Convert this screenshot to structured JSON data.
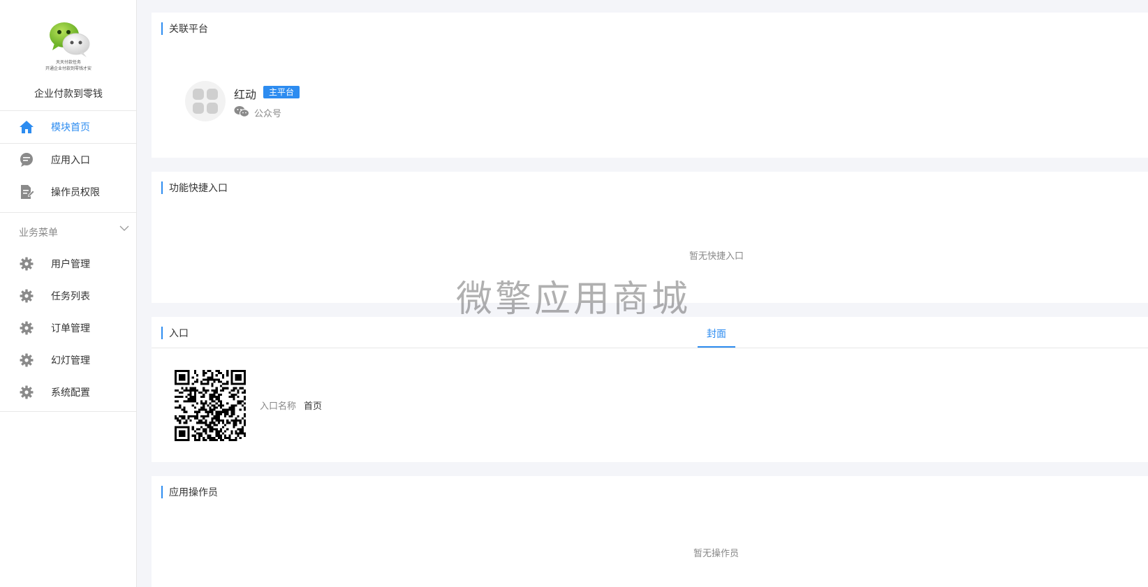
{
  "sidebar": {
    "logo_caption_line1": "天天付款任务",
    "logo_caption_line2": "开通企业付款到零钱才安",
    "app_name": "企业付款到零钱",
    "nav": [
      {
        "label": "模块首页",
        "icon": "home-icon",
        "active": true
      },
      {
        "label": "应用入口",
        "icon": "chat-bubble-icon"
      },
      {
        "label": "操作员权限",
        "icon": "document-edit-icon"
      }
    ],
    "menu_title": "业务菜单",
    "menu_items": [
      {
        "label": "用户管理",
        "icon": "gear-icon"
      },
      {
        "label": "任务列表",
        "icon": "gear-icon"
      },
      {
        "label": "订单管理",
        "icon": "gear-icon"
      },
      {
        "label": "幻灯管理",
        "icon": "gear-icon"
      },
      {
        "label": "系统配置",
        "icon": "gear-icon"
      }
    ]
  },
  "main": {
    "platform_card": {
      "title": "关联平台",
      "platform_name": "红动",
      "badge": "主平台",
      "platform_type": "公众号"
    },
    "shortcut_card": {
      "title": "功能快捷入口",
      "empty_text": "暂无快捷入口"
    },
    "entry_card": {
      "title": "入口",
      "tab_label": "封面",
      "entry_name_label": "入口名称",
      "entry_name_value": "首页"
    },
    "operator_card": {
      "title": "应用操作员",
      "empty_text": "暂无操作员"
    }
  },
  "watermark": "微擎应用商城",
  "colors": {
    "accent": "#2d8cf0",
    "background": "#f4f5f9",
    "icon_gray": "#8a8a8a"
  }
}
